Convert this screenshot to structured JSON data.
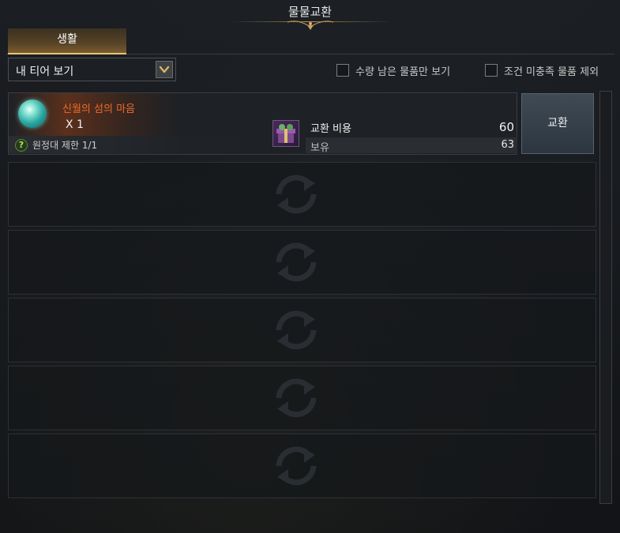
{
  "window": {
    "title": "물물교환"
  },
  "tabs": [
    {
      "label": "생활",
      "active": true
    }
  ],
  "filter": {
    "tier_select": {
      "value": "내 티어 보기"
    },
    "checkbox_remaining": {
      "label": "수량 남은 물품만 보기",
      "checked": false
    },
    "checkbox_exclude": {
      "label": "조건 미충족 물품 제외",
      "checked": false
    }
  },
  "items": [
    {
      "name": "신월의 섬의 마음",
      "quantity": "X 1",
      "limit_text": "원정대 제한 1/1",
      "cost_label": "교환 비용",
      "cost_value": "60",
      "owned_label": "보유",
      "owned_value": "63",
      "button_label": "교환"
    }
  ],
  "colors": {
    "item_name": "#ee6a2a",
    "tab_accent": "#e6c27a",
    "button_bg": "#3e4a55"
  },
  "icons": {
    "item": "orb-icon",
    "cost": "gift-box-icon",
    "help": "question-icon",
    "dropdown": "chevron-down-icon",
    "empty_slot": "swap-arrows-icon"
  }
}
